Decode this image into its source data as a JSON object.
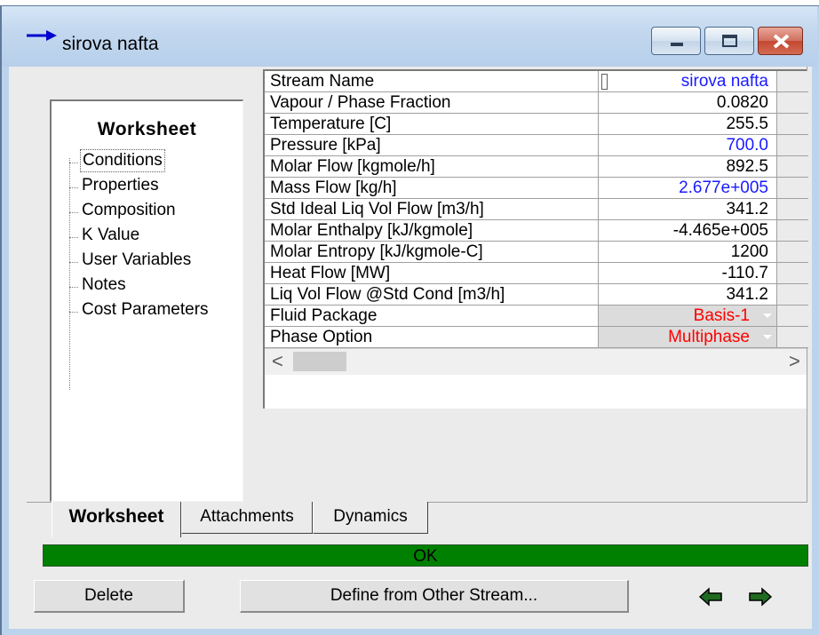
{
  "window": {
    "title": "sirova nafta",
    "icon": "stream-arrow-icon",
    "caption_buttons": [
      "minimize-icon",
      "maximize-icon",
      "close-icon"
    ]
  },
  "nav": {
    "title": "Worksheet",
    "items": [
      {
        "label": "Conditions",
        "selected": true
      },
      {
        "label": "Properties"
      },
      {
        "label": "Composition"
      },
      {
        "label": "K Value"
      },
      {
        "label": "User Variables"
      },
      {
        "label": "Notes"
      },
      {
        "label": "Cost Parameters"
      }
    ]
  },
  "grid": {
    "rows": [
      {
        "name": "Stream Name",
        "value": "sirova nafta",
        "color": "#1a1aff"
      },
      {
        "name": "Vapour / Phase Fraction",
        "value": "0.0820",
        "color": "#000000"
      },
      {
        "name": "Temperature [C]",
        "value": "255.5",
        "color": "#000000"
      },
      {
        "name": "Pressure [kPa]",
        "value": "700.0",
        "color": "#1a1aff"
      },
      {
        "name": "Molar Flow [kgmole/h]",
        "value": "892.5",
        "color": "#000000"
      },
      {
        "name": "Mass Flow [kg/h]",
        "value": "2.677e+005",
        "color": "#1a1aff"
      },
      {
        "name": "Std Ideal Liq Vol Flow [m3/h]",
        "value": "341.2",
        "color": "#000000"
      },
      {
        "name": "Molar Enthalpy [kJ/kgmole]",
        "value": "-4.465e+005",
        "color": "#000000"
      },
      {
        "name": "Molar Entropy [kJ/kgmole-C]",
        "value": "1200",
        "color": "#000000"
      },
      {
        "name": "Heat Flow [MW]",
        "value": "-110.7",
        "color": "#000000"
      },
      {
        "name": "Liq Vol Flow @Std Cond [m3/h]",
        "value": "341.2",
        "color": "#000000"
      },
      {
        "name": "Fluid Package",
        "value": "Basis-1",
        "color": "#ff0000",
        "dropdown": true
      },
      {
        "name": "Phase Option",
        "value": "Multiphase",
        "color": "#ff0000",
        "dropdown": true
      }
    ],
    "scroll_left": "<",
    "scroll_right": ">"
  },
  "tabs": [
    {
      "label": "Worksheet",
      "active": true
    },
    {
      "label": "Attachments"
    },
    {
      "label": "Dynamics"
    }
  ],
  "status": {
    "text": "OK",
    "color": "#008000"
  },
  "buttons": {
    "delete": "Delete",
    "define_from_other": "Define from Other Stream..."
  },
  "nav_arrows": [
    "arrow-left-icon",
    "arrow-right-icon"
  ],
  "colors": {
    "arrow_green": "#1f6b1f",
    "title_arrow_blue": "#0000d0"
  }
}
